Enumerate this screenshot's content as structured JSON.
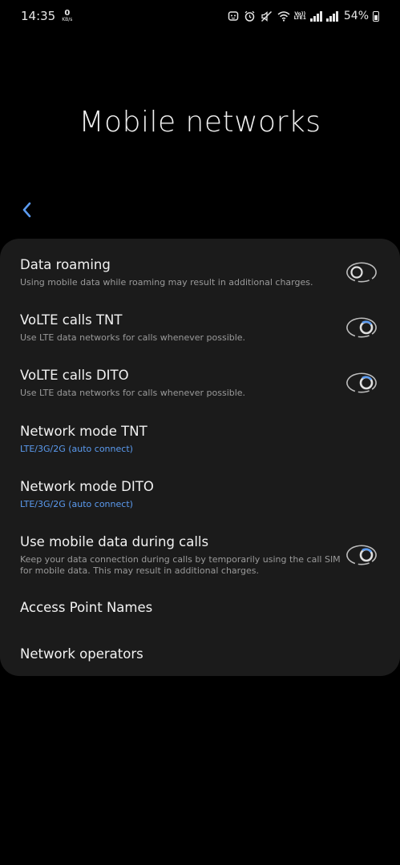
{
  "status_bar": {
    "time": "14:35",
    "data_speed_value": "0",
    "data_speed_unit": "KB/s",
    "volte_label_top": "Vo))",
    "volte_label_bottom": "LTE1",
    "battery_percent": "54%",
    "icons": [
      "face-icon",
      "alarm-icon",
      "mute-icon",
      "wifi-icon",
      "volte-icon",
      "signal-icon",
      "signal-icon",
      "battery-icon"
    ]
  },
  "page": {
    "title": "Mobile networks",
    "back_icon": "chevron-left-icon"
  },
  "colors": {
    "background": "#000000",
    "card": "#1b1b1b",
    "accent_blue": "#5b9bf0",
    "secondary_text": "#9a9a9a"
  },
  "settings": [
    {
      "title": "Data roaming",
      "subtitle": "Using mobile data while roaming may result in additional charges.",
      "toggle": "off"
    },
    {
      "title": "VoLTE calls TNT",
      "subtitle": "Use LTE data networks for calls whenever possible.",
      "toggle": "on"
    },
    {
      "title": "VoLTE calls DITO",
      "subtitle": "Use LTE data networks for calls whenever possible.",
      "toggle": "on"
    },
    {
      "title": "Network mode TNT",
      "subtitle": "LTE/3G/2G (auto connect)"
    },
    {
      "title": "Network mode DITO",
      "subtitle": "LTE/3G/2G (auto connect)"
    },
    {
      "title": "Use mobile data during calls",
      "subtitle": "Keep your data connection during calls by temporarily using the call SIM for mobile data. This may result in additional charges.",
      "toggle": "on"
    },
    {
      "title": "Access Point Names"
    },
    {
      "title": "Network operators"
    }
  ]
}
